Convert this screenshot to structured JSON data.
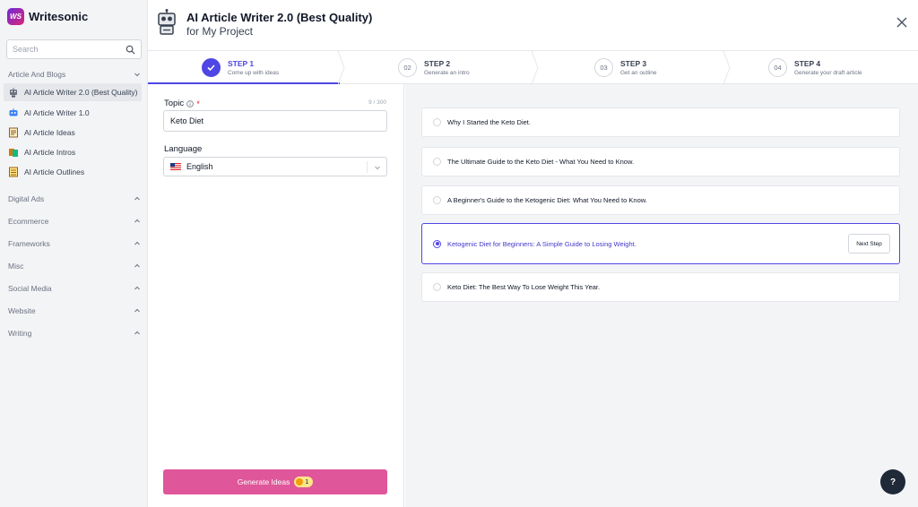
{
  "brand": {
    "logo_text": "WS",
    "name": "Writesonic"
  },
  "sidebar": {
    "search_placeholder": "Search",
    "categories": [
      {
        "label": "Article And Blogs"
      },
      {
        "label": "Digital Ads"
      },
      {
        "label": "Ecommerce"
      },
      {
        "label": "Frameworks"
      },
      {
        "label": "Misc"
      },
      {
        "label": "Social Media"
      },
      {
        "label": "Website"
      },
      {
        "label": "Writing"
      }
    ],
    "items": [
      {
        "label": "AI Article Writer 2.0 (Best Quality)",
        "icon": "robot-icon",
        "color": "#6b7280"
      },
      {
        "label": "AI Article Writer 1.0",
        "icon": "robot-blue-icon",
        "color": "#3b82f6"
      },
      {
        "label": "AI Article Ideas",
        "icon": "document-icon",
        "color": "#8b5a2b"
      },
      {
        "label": "AI Article Intros",
        "icon": "cards-icon",
        "color": "#d97706"
      },
      {
        "label": "AI Article Outlines",
        "icon": "list-icon",
        "color": "#a16207"
      }
    ]
  },
  "header": {
    "title": "AI Article Writer 2.0 (Best Quality)",
    "subtitle": "for My Project"
  },
  "steps": [
    {
      "label": "STEP 1",
      "desc": "Come up with ideas",
      "number": ""
    },
    {
      "label": "STEP 2",
      "desc": "Generate an intro",
      "number": "02"
    },
    {
      "label": "STEP 3",
      "desc": "Get an outline",
      "number": "03"
    },
    {
      "label": "STEP 4",
      "desc": "Generate your draft article",
      "number": "04"
    }
  ],
  "form": {
    "topic_label": "Topic",
    "required_mark": "*",
    "topic_counter": "9 / 300",
    "topic_value": "Keto Diet",
    "language_label": "Language",
    "language_value": "English",
    "generate_label": "Generate Ideas",
    "credits": "1"
  },
  "ideas": [
    {
      "text": "Why I Started the Keto Diet."
    },
    {
      "text": "The Ultimate Guide to the Keto Diet - What You Need to Know."
    },
    {
      "text": "A Beginner's Guide to the Ketogenic Diet: What You Need to Know."
    },
    {
      "text": "Ketogenic Diet for Beginners: A Simple Guide to Losing Weight.",
      "selected": true
    },
    {
      "text": "Keto Diet: The Best Way To Lose Weight This Year."
    }
  ],
  "next_step_label": "Next Step",
  "help_label": "?",
  "colors": {
    "accent": "#4f46e5",
    "generate_button": "#e0569a"
  }
}
